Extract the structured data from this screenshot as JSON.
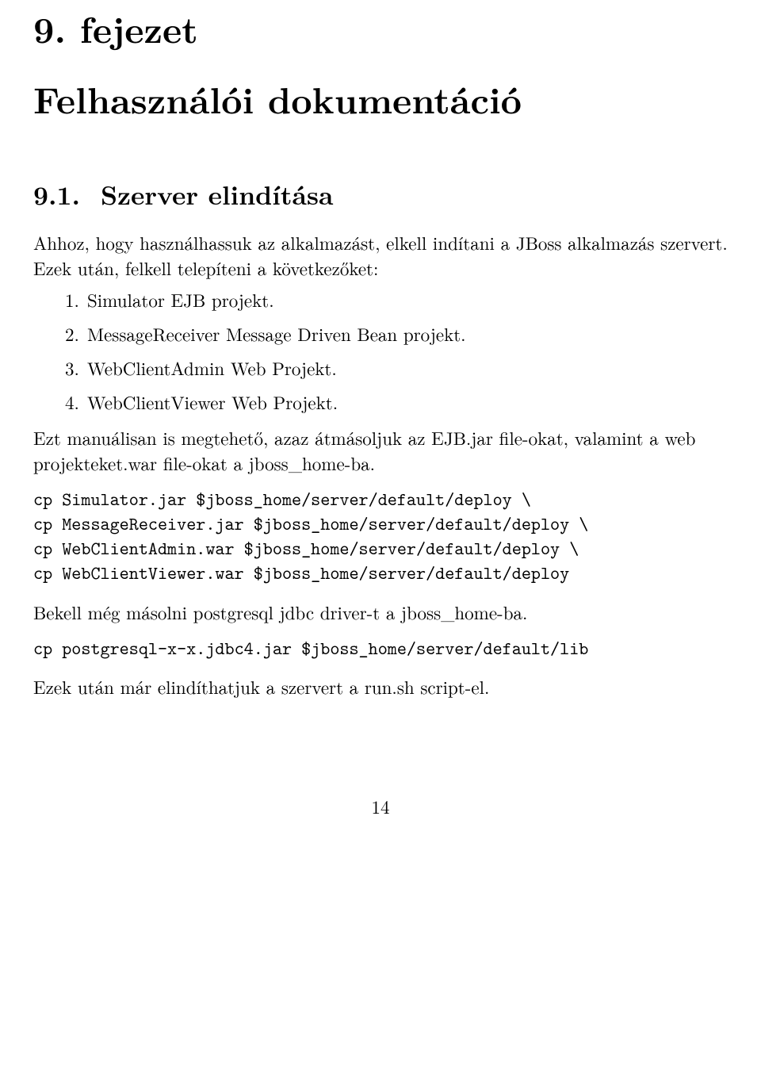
{
  "chapter": {
    "label": "9. fejezet",
    "title": "Felhasználói dokumentáció"
  },
  "section": {
    "number": "9.1.",
    "title": "Szerver elindítása"
  },
  "para1": "Ahhoz, hogy használhassuk az alkalmazást, elkell indítani a JBoss alkalmazás szervert. Ezek után, felkell telepíteni a következőket:",
  "list": [
    {
      "num": "1.",
      "text": "Simulator EJB projekt."
    },
    {
      "num": "2.",
      "text": "MessageReceiver Message Driven Bean projekt."
    },
    {
      "num": "3.",
      "text": "WebClientAdmin Web Projekt."
    },
    {
      "num": "4.",
      "text": "WebClientViewer Web Projekt."
    }
  ],
  "para2": "Ezt manuálisan is megtehető, azaz átmásoljuk az EJB.jar file-okat, valamint a web projekteket.war file-okat a jboss_home-ba.",
  "code1": "cp Simulator.jar $jboss_home/server/default/deploy \\\ncp MessageReceiver.jar $jboss_home/server/default/deploy \\\ncp WebClientAdmin.war $jboss_home/server/default/deploy \\\ncp WebClientViewer.war $jboss_home/server/default/deploy",
  "para3": "Bekell még másolni postgresql jdbc driver-t a jboss_home-ba.",
  "code2": "cp postgresql-x-x.jdbc4.jar $jboss_home/server/default/lib",
  "para4": "Ezek után már elindíthatjuk a szervert a run.sh script-el.",
  "pageNumber": "14"
}
